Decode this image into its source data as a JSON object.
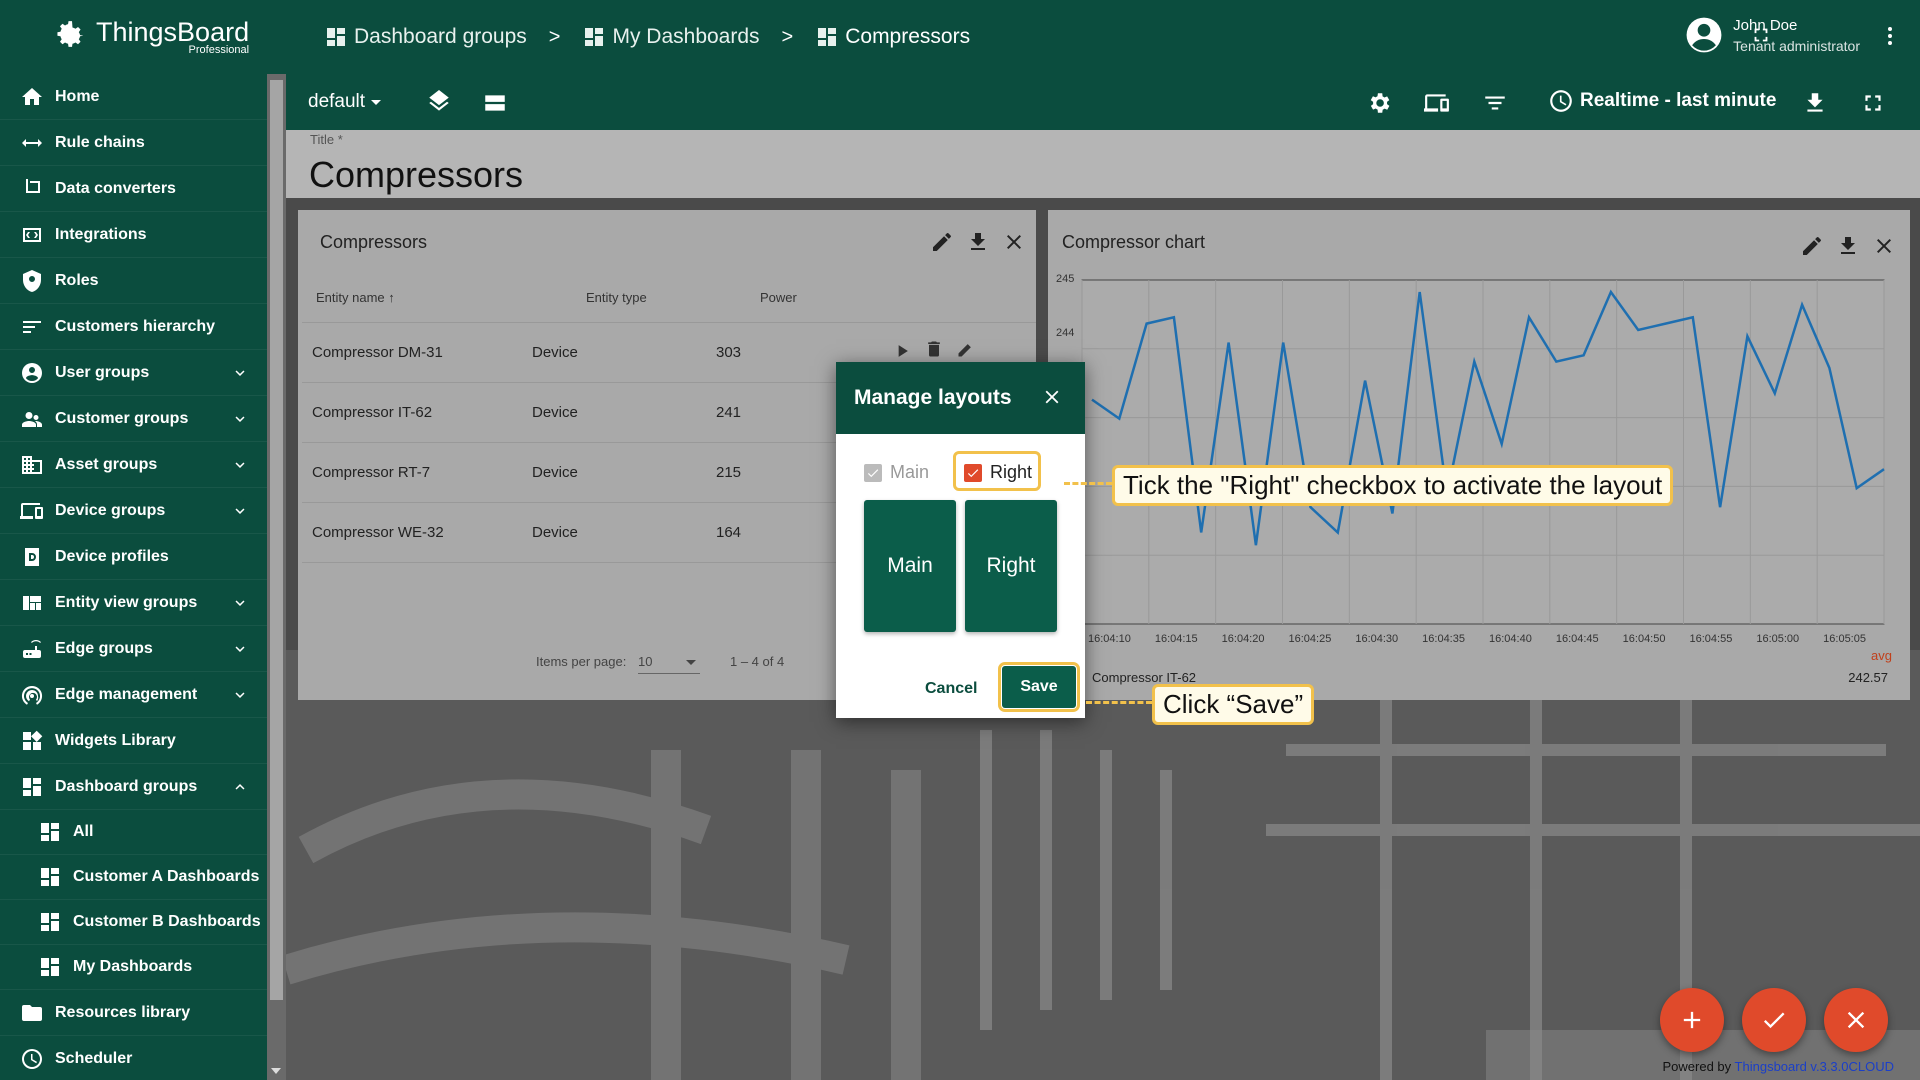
{
  "app": {
    "name": "ThingsBoard",
    "edition": "Professional"
  },
  "breadcrumbs": [
    "Dashboard groups",
    "My Dashboards",
    "Compressors"
  ],
  "user": {
    "name": "John Doe",
    "role": "Tenant administrator"
  },
  "sidebar": {
    "items": [
      {
        "label": "Home",
        "icon": "home-icon"
      },
      {
        "label": "Rule chains",
        "icon": "rule-chains-icon"
      },
      {
        "label": "Data converters",
        "icon": "converters-icon"
      },
      {
        "label": "Integrations",
        "icon": "integrations-icon"
      },
      {
        "label": "Roles",
        "icon": "shield-icon"
      },
      {
        "label": "Customers hierarchy",
        "icon": "hierarchy-icon"
      },
      {
        "label": "User groups",
        "icon": "account-icon",
        "expandable": true
      },
      {
        "label": "Customer groups",
        "icon": "supervisor-icon",
        "expandable": true
      },
      {
        "label": "Asset groups",
        "icon": "domain-icon",
        "expandable": true
      },
      {
        "label": "Device groups",
        "icon": "devices-icon",
        "expandable": true
      },
      {
        "label": "Device profiles",
        "icon": "device-profile-icon"
      },
      {
        "label": "Entity view groups",
        "icon": "view-quilt-icon",
        "expandable": true
      },
      {
        "label": "Edge groups",
        "icon": "router-icon",
        "expandable": true
      },
      {
        "label": "Edge management",
        "icon": "wifi-tethering-icon",
        "expandable": true
      },
      {
        "label": "Widgets Library",
        "icon": "widgets-icon"
      },
      {
        "label": "Dashboard groups",
        "icon": "dashboard-icon",
        "expanded": true
      }
    ],
    "subitems": [
      {
        "label": "All"
      },
      {
        "label": "Customer A Dashboards"
      },
      {
        "label": "Customer B Dashboards"
      },
      {
        "label": "My Dashboards"
      }
    ],
    "after": [
      {
        "label": "Resources library",
        "icon": "folder-icon"
      },
      {
        "label": "Scheduler",
        "icon": "schedule-icon"
      }
    ]
  },
  "toolbar": {
    "layout": "default",
    "timewindow": "Realtime - last minute"
  },
  "dashboard": {
    "title_label": "Title *",
    "title": "Compressors"
  },
  "table_widget": {
    "title": "Compressors",
    "columns": [
      "Entity name",
      "Entity type",
      "Power"
    ],
    "rows": [
      [
        "Compressor DM-31",
        "Device",
        "303"
      ],
      [
        "Compressor IT-62",
        "Device",
        "241"
      ],
      [
        "Compressor RT-7",
        "Device",
        "215"
      ],
      [
        "Compressor WE-32",
        "Device",
        "164"
      ]
    ],
    "items_per_page_label": "Items per page:",
    "items_per_page": "10",
    "range": "1 – 4 of 4"
  },
  "chart_widget": {
    "title": "Compressor chart",
    "legend_header": "avg",
    "legend_series": "Compressor IT-62",
    "legend_value": "242.57"
  },
  "chart_data": {
    "type": "line",
    "title": "Compressor chart",
    "ytick_labels": [
      "245",
      "244"
    ],
    "xtick_labels": [
      "16:04:10",
      "16:04:15",
      "16:04:20",
      "16:04:25",
      "16:04:30",
      "16:04:35",
      "16:04:40",
      "16:04:45",
      "16:04:50",
      "16:04:55",
      "16:05:00",
      "16:05:05"
    ],
    "series": [
      {
        "name": "Compressor IT-62",
        "color": "#1f6fb0",
        "values": [
          243.3,
          243.0,
          244.5,
          244.6,
          241.2,
          244.2,
          241.0,
          244.2,
          241.6,
          241.2,
          243.6,
          241.5,
          245.0,
          241.8,
          243.9,
          242.6,
          244.6,
          243.9,
          244.0,
          245.0,
          244.4,
          244.5,
          244.6,
          241.6,
          244.3,
          243.4,
          244.8,
          243.8,
          241.9,
          242.2
        ]
      }
    ],
    "grid": true
  },
  "dialog": {
    "title": "Manage layouts",
    "checkbox_main": "Main",
    "checkbox_right": "Right",
    "layout_main": "Main",
    "layout_right": "Right",
    "cancel": "Cancel",
    "save": "Save"
  },
  "callouts": {
    "tick": "Tick the \"Right\" checkbox to activate the layout",
    "save": "Click “Save”"
  },
  "footer": {
    "powered_prefix": "Powered by",
    "powered_link": "Thingsboard v.3.3.0CLOUD"
  },
  "colors": {
    "primary": "#0b4d3e",
    "accent": "#e04a2b",
    "highlight": "#f2c14b"
  }
}
